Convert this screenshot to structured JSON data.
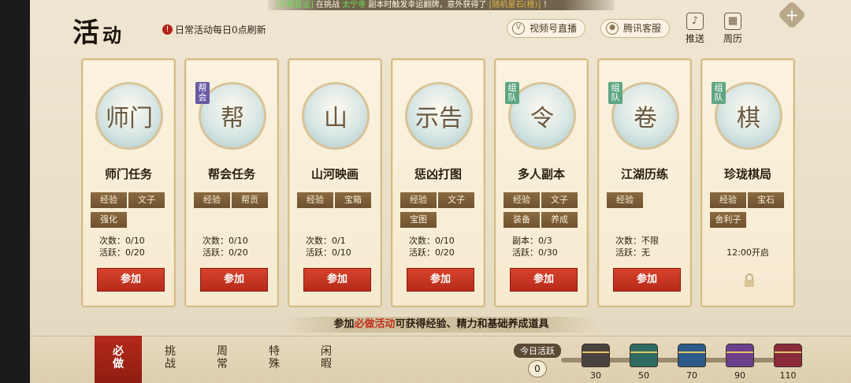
{
  "header": {
    "title_main": "活",
    "title_sub": "动",
    "notice_icon": "!",
    "notice": "日常活动每日0点刷新",
    "ticker_prefix": "[天赐星运]",
    "ticker_a": "在挑战",
    "ticker_hl": "太宁寺",
    "ticker_b": "副本时触发幸运翻牌，意外获得了",
    "ticker_item": "[随机星石(橙)]",
    "ticker_end": "！",
    "video_label": "视频号直播",
    "service_label": "腾讯客服",
    "push_label": "推送",
    "calendar_label": "周历"
  },
  "activities": [
    {
      "name": "师门任务",
      "badge": "",
      "tags": [
        "经验",
        "文子",
        "强化"
      ],
      "stats": [
        "次数：0/10",
        "活跃：0/20"
      ],
      "button": "参加",
      "icon": "medal-icon",
      "img_text": "师门"
    },
    {
      "name": "帮会任务",
      "badge": "帮会",
      "tags": [
        "经验",
        "帮贡"
      ],
      "stats": [
        "次数：0/10",
        "活跃：0/20"
      ],
      "button": "参加",
      "icon": "guild-emblem-icon",
      "img_text": "帮"
    },
    {
      "name": "山河映画",
      "badge": "",
      "tags": [
        "经验",
        "宝箱"
      ],
      "stats": [
        "次数：0/1",
        "活跃：0/10"
      ],
      "button": "参加",
      "icon": "landscape-painting-icon",
      "img_text": "山"
    },
    {
      "name": "惩凶打图",
      "badge": "",
      "tags": [
        "经验",
        "文子",
        "宝图"
      ],
      "stats": [
        "次数：0/10",
        "活跃：0/20"
      ],
      "button": "参加",
      "icon": "wanted-poster-icon",
      "img_text": "示告"
    },
    {
      "name": "多人副本",
      "badge": "组队",
      "tags": [
        "经验",
        "文子",
        "装备",
        "养成"
      ],
      "stats": [
        "副本：0/3",
        "活跃：0/30"
      ],
      "button": "参加",
      "icon": "jade-token-icon",
      "img_text": "令"
    },
    {
      "name": "江湖历练",
      "badge": "组队",
      "tags": [
        "经验"
      ],
      "stats": [
        "次数：不限",
        "活跃：无"
      ],
      "button": "参加",
      "icon": "scroll-icon",
      "img_text": "卷"
    },
    {
      "name": "珍珑棋局",
      "badge": "组队",
      "tags": [
        "经验",
        "宝石",
        "舍利子"
      ],
      "stats": [],
      "time": "12:00开启",
      "button": "",
      "icon": "go-board-icon",
      "img_text": "棋"
    }
  ],
  "footnote": {
    "prefix": "参加",
    "highlight": "必做活动",
    "suffix": "可获得经验、精力和基础养成道具"
  },
  "tabs": [
    {
      "l1": "必",
      "l2": "做",
      "active": true
    },
    {
      "l1": "挑",
      "l2": "战",
      "active": false
    },
    {
      "l1": "周",
      "l2": "常",
      "active": false
    },
    {
      "l1": "特",
      "l2": "殊",
      "active": false
    },
    {
      "l1": "闲",
      "l2": "暇",
      "active": false
    }
  ],
  "activity_progress": {
    "label": "今日活跃",
    "value": "0",
    "fill_fraction": 0,
    "milestones": [
      "30",
      "50",
      "70",
      "90",
      "110"
    ],
    "chest_colors": [
      "#4a4440",
      "#2f6b62",
      "#2d5a8a",
      "#6b3f8a",
      "#8a2a3a"
    ]
  },
  "colors": {
    "accent_red": "#b72a1a",
    "tag_brown": "#7a5a36",
    "card_border": "#d6bb86"
  }
}
